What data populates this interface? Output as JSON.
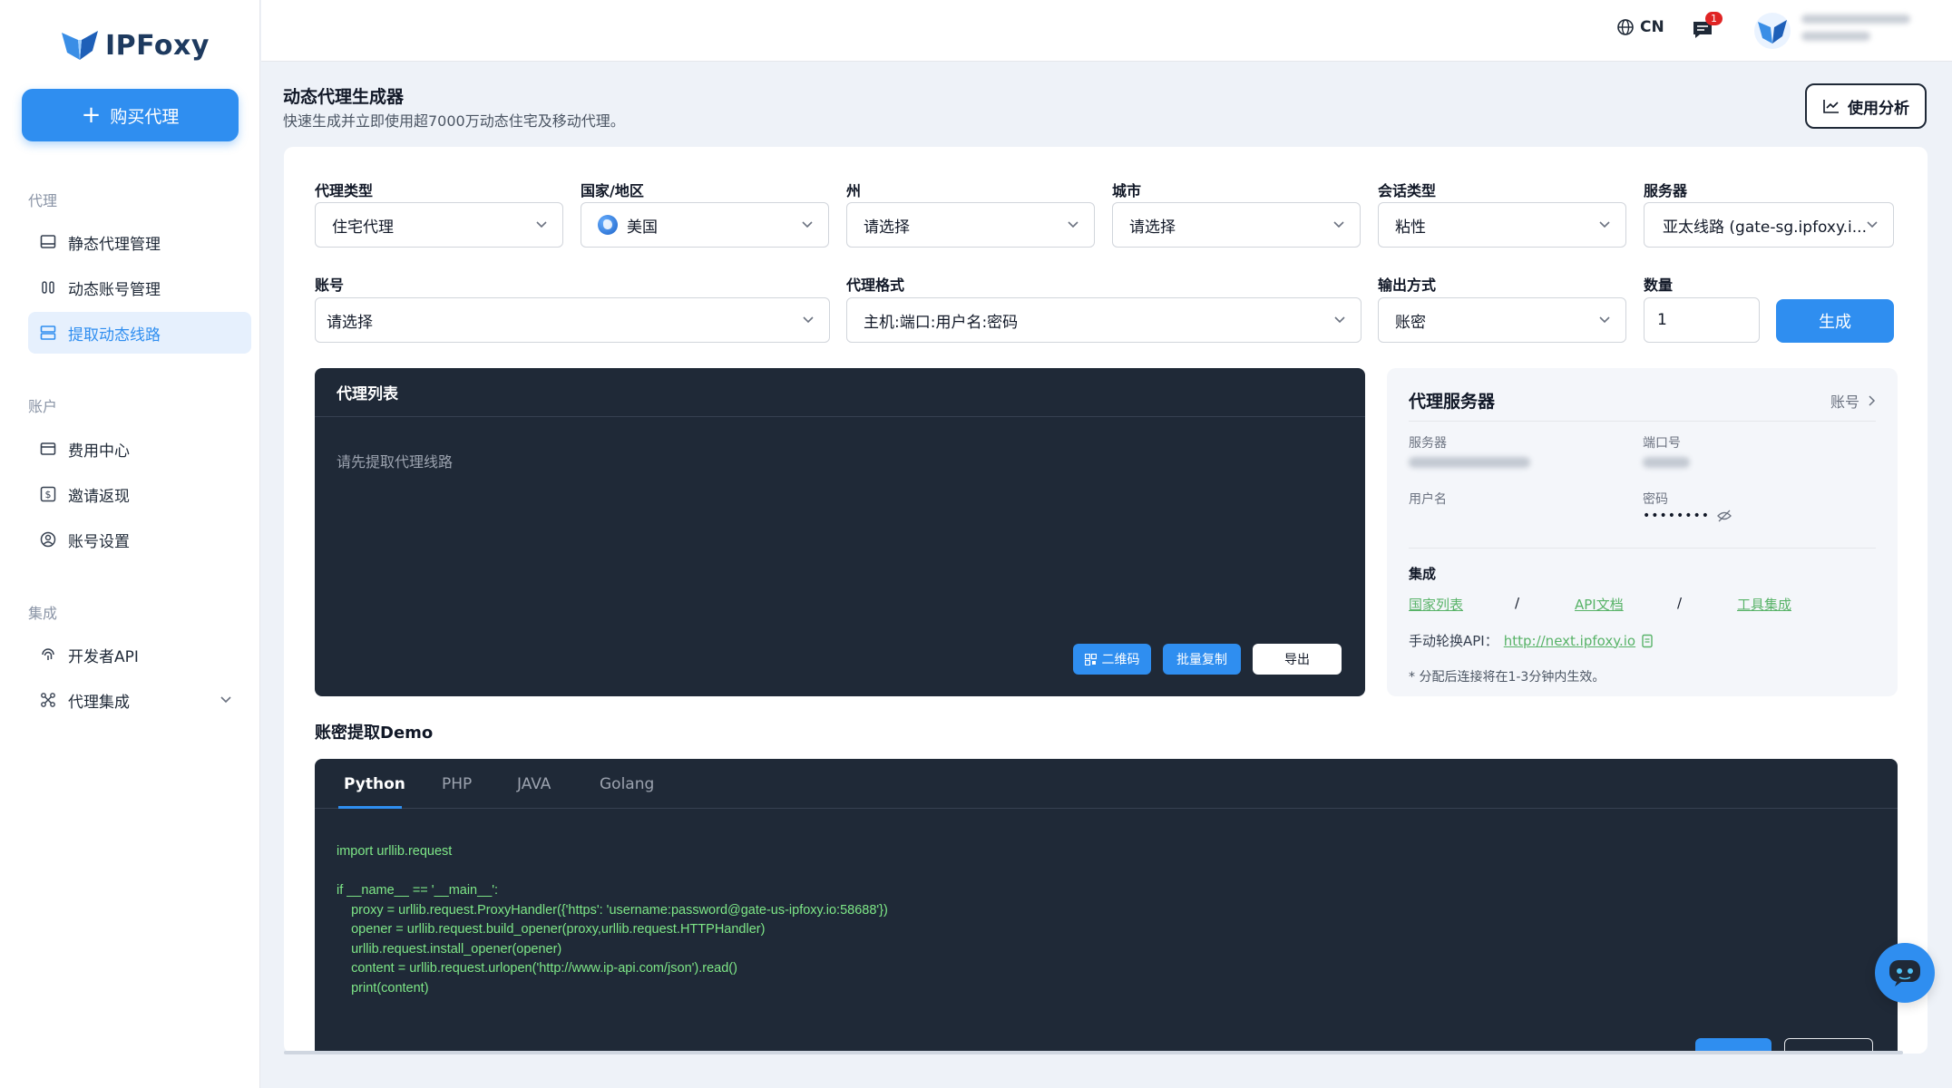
{
  "brand": {
    "name": "IPFoxy"
  },
  "sidebar": {
    "buy_label": "购买代理",
    "sections": [
      {
        "title": "代理",
        "items": [
          {
            "label": "静态代理管理"
          },
          {
            "label": "动态账号管理"
          },
          {
            "label": "提取动态线路"
          }
        ]
      },
      {
        "title": "账户",
        "items": [
          {
            "label": "费用中心"
          },
          {
            "label": "邀请返现"
          },
          {
            "label": "账号设置"
          }
        ]
      },
      {
        "title": "集成",
        "items": [
          {
            "label": "开发者API"
          },
          {
            "label": "代理集成"
          }
        ]
      }
    ]
  },
  "header": {
    "language": "CN",
    "notification_count": "1"
  },
  "page": {
    "title": "动态代理生成器",
    "subtitle": "快速生成并立即使用超7000万动态住宅及移动代理。",
    "analysis_label": "使用分析"
  },
  "form": {
    "proxy_type": {
      "label": "代理类型",
      "value": "住宅代理"
    },
    "country": {
      "label": "国家/地区",
      "value": "美国"
    },
    "state": {
      "label": "州",
      "value": "请选择"
    },
    "city": {
      "label": "城市",
      "value": "请选择"
    },
    "session": {
      "label": "会话类型",
      "value": "粘性"
    },
    "server": {
      "label": "服务器",
      "value": "亚太线路 (gate-sg.ipfoxy.i..."
    },
    "account": {
      "label": "账号",
      "value": "请选择"
    },
    "format": {
      "label": "代理格式",
      "value": "主机:端口:用户名:密码"
    },
    "output": {
      "label": "输出方式",
      "value": "账密"
    },
    "quantity": {
      "label": "数量",
      "value": "1"
    },
    "generate_label": "生成"
  },
  "proxy_list": {
    "title": "代理列表",
    "empty_text": "请先提取代理线路",
    "qr_label": "二维码",
    "copy_label": "批量复制",
    "export_label": "导出"
  },
  "server_panel": {
    "title": "代理服务器",
    "account_link": "账号",
    "server_label": "服务器",
    "port_label": "端口号",
    "username_label": "用户名",
    "password_label": "密码",
    "password_value": "••••••••",
    "integration_title": "集成",
    "links": {
      "countries": "国家列表",
      "api_docs": "API文档",
      "tools": "工具集成"
    },
    "rotate_label": "手动轮换API：",
    "rotate_url": "http://next.ipfoxy.io",
    "note": "* 分配后连接将在1-3分钟内生效。"
  },
  "demo": {
    "title": "账密提取Demo",
    "tabs": [
      {
        "label": "Python"
      },
      {
        "label": "PHP"
      },
      {
        "label": "JAVA"
      },
      {
        "label": "Golang"
      }
    ],
    "code": "import urllib.request\n\nif __name__ == '__main__':\n    proxy = urllib.request.ProxyHandler({'https': 'username:password@gate-us-ipfoxy.io:58688'})\n    opener = urllib.request.build_opener(proxy,urllib.request.HTTPHandler)\n    urllib.request.install_opener(opener)\n    content = urllib.request.urlopen('http://www.ip-api.com/json').read()\n    print(content)"
  },
  "colors": {
    "accent": "#2f8ef0",
    "dark_panel": "#1f2937",
    "link_green": "#58b368"
  }
}
